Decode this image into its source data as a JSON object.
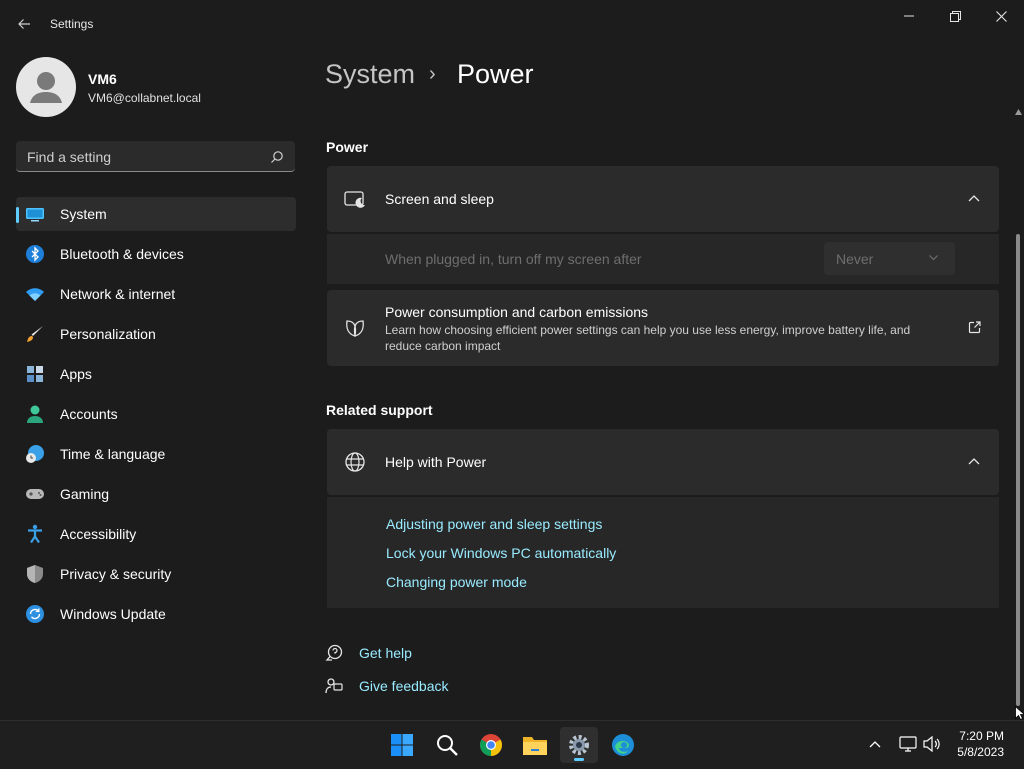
{
  "window": {
    "title": "Settings"
  },
  "user": {
    "name": "VM6",
    "email": "VM6@collabnet.local"
  },
  "search": {
    "placeholder": "Find a setting"
  },
  "nav": {
    "items": [
      {
        "label": "System",
        "icon": "monitor-icon",
        "selected": true
      },
      {
        "label": "Bluetooth & devices",
        "icon": "bluetooth-icon"
      },
      {
        "label": "Network & internet",
        "icon": "wifi-icon"
      },
      {
        "label": "Personalization",
        "icon": "brush-icon"
      },
      {
        "label": "Apps",
        "icon": "apps-icon"
      },
      {
        "label": "Accounts",
        "icon": "person-icon"
      },
      {
        "label": "Time & language",
        "icon": "globe-clock-icon"
      },
      {
        "label": "Gaming",
        "icon": "gamepad-icon"
      },
      {
        "label": "Accessibility",
        "icon": "accessibility-icon"
      },
      {
        "label": "Privacy & security",
        "icon": "shield-icon"
      },
      {
        "label": "Windows Update",
        "icon": "update-icon"
      }
    ]
  },
  "breadcrumb": {
    "parent": "System",
    "separator": "›",
    "current": "Power"
  },
  "power_section": {
    "title": "Power",
    "screen_sleep": {
      "title": "Screen and sleep",
      "plugged_label": "When plugged in, turn off my screen after",
      "plugged_value": "Never"
    },
    "carbon": {
      "title": "Power consumption and carbon emissions",
      "desc_line1": "Learn how choosing efficient power settings can help you use less energy, improve battery life, and",
      "desc_line2": "reduce carbon impact"
    }
  },
  "related": {
    "title": "Related support",
    "help_title": "Help with Power",
    "links": [
      "Adjusting power and sleep settings",
      "Lock your Windows PC automatically",
      "Changing power mode"
    ]
  },
  "footer": {
    "get_help": "Get help",
    "give_feedback": "Give feedback"
  },
  "taskbar": {
    "apps": [
      "start-icon",
      "search-icon",
      "chrome-icon",
      "file-explorer-icon",
      "settings-icon",
      "edge-icon"
    ],
    "time": "7:20 PM",
    "date": "5/8/2023"
  },
  "colors": {
    "accent": "#60cdff",
    "link": "#99ebff",
    "background": "#1c1c1c",
    "card": "#2b2b2b"
  }
}
